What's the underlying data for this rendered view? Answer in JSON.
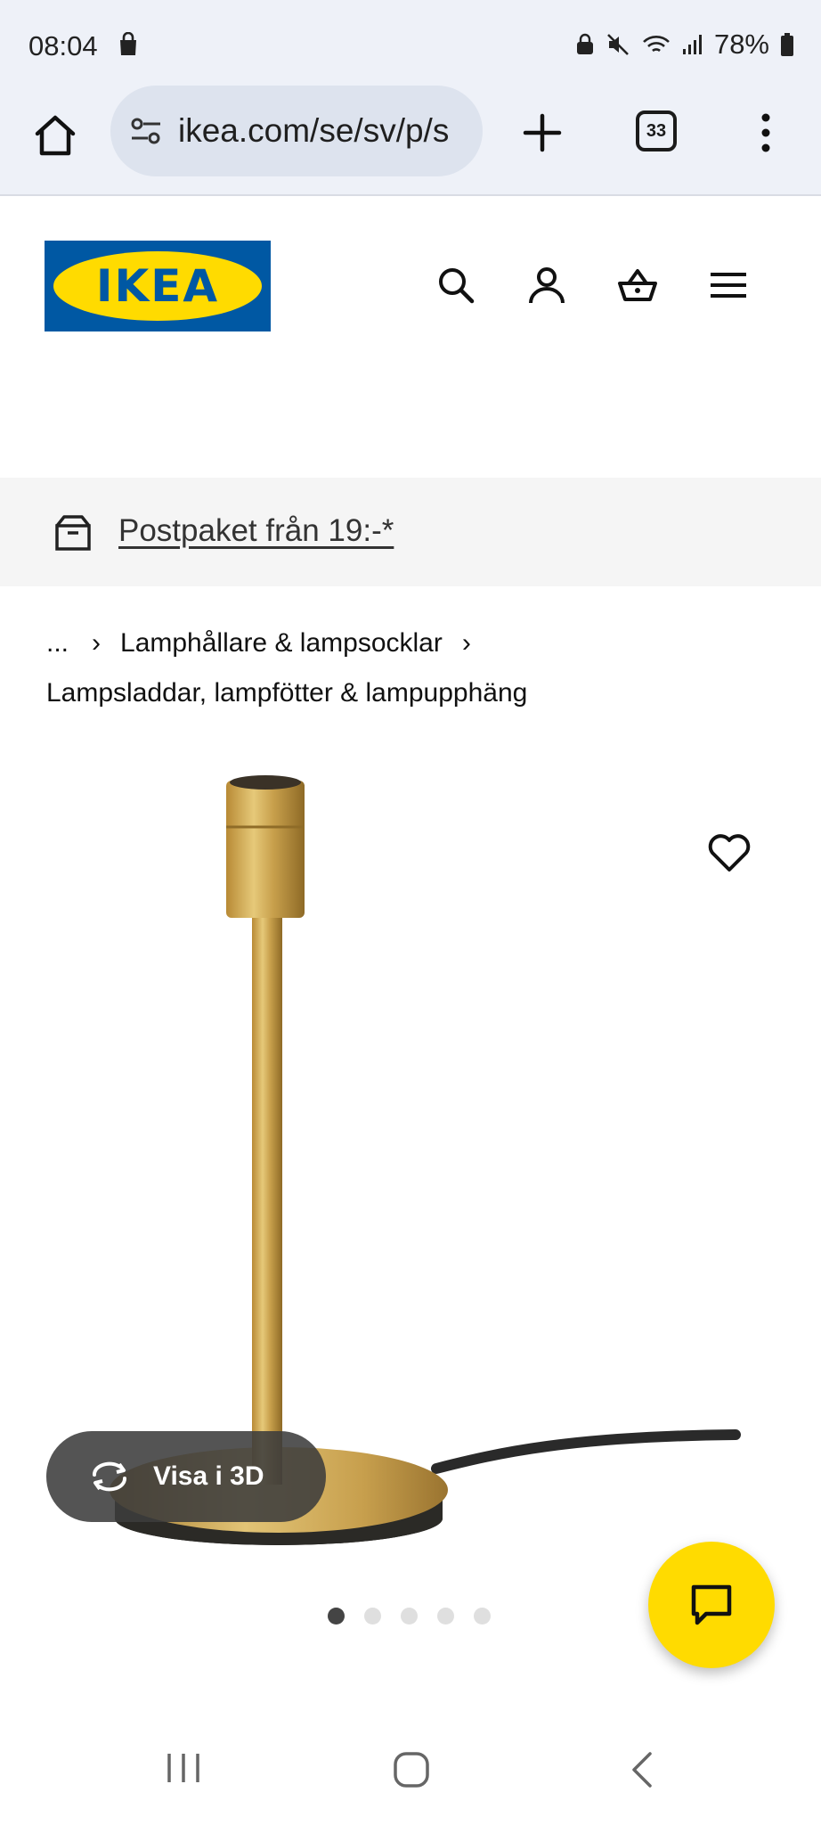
{
  "status_bar": {
    "time": "08:04",
    "battery": "78%"
  },
  "browser": {
    "url": "ikea.com/se/sv/p/s",
    "tab_count": "33"
  },
  "header": {
    "logo_text": "IKEA",
    "icons": [
      "search-icon",
      "user-icon",
      "cart-icon",
      "hamburger-icon"
    ]
  },
  "promo": {
    "text": "Postpaket från 19:-*"
  },
  "breadcrumb": {
    "ellipsis": "...",
    "separator": "›",
    "items": [
      "Lamphållare & lampsocklar",
      "Lampsladdar, lampfötter & lampupphäng"
    ]
  },
  "product_media": {
    "view3d_label": "Visa i 3D",
    "image_count": 5,
    "active_image": 1
  },
  "colors": {
    "ikea_blue": "#0058a3",
    "ikea_yellow": "#ffdb00",
    "brass": "#c9a14a"
  }
}
